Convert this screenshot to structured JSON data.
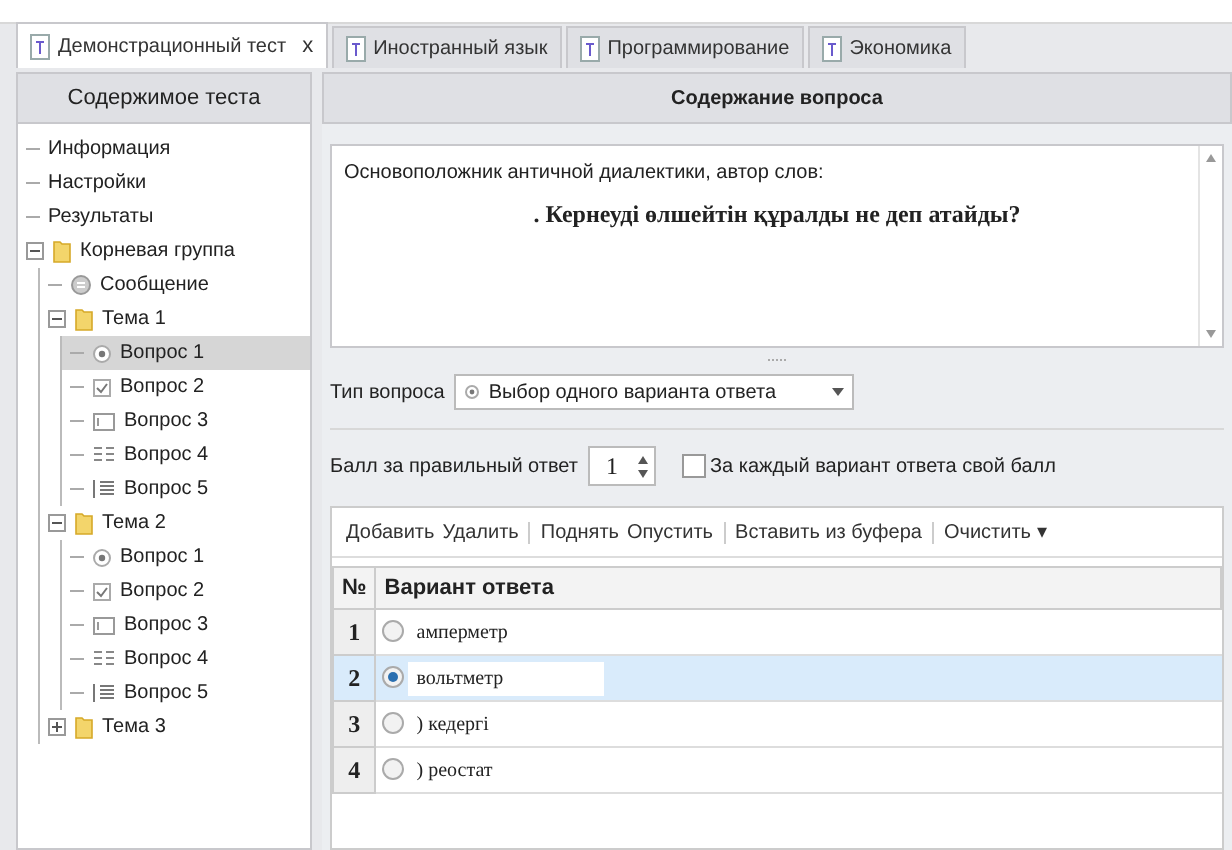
{
  "tabs": [
    {
      "label": "Демонстрационный тест",
      "selected": true,
      "close": "x"
    },
    {
      "label": "Иностранный язык",
      "selected": false
    },
    {
      "label": "Программирование",
      "selected": false
    },
    {
      "label": "Экономика",
      "selected": false
    }
  ],
  "tree": {
    "title": "Содержимое теста",
    "items": [
      {
        "label": "Информация",
        "kind": "page",
        "selected": false
      },
      {
        "label": "Настройки",
        "kind": "page",
        "selected": false
      },
      {
        "label": "Результаты",
        "kind": "page",
        "selected": false
      },
      {
        "label": "Корневая группа",
        "kind": "folder",
        "selected": false,
        "expanded": true,
        "children": [
          {
            "label": "Сообщение",
            "kind": "message",
            "selected": false
          },
          {
            "label": "Тема 1",
            "kind": "folder",
            "selected": false,
            "expanded": true,
            "children": [
              {
                "label": "Вопрос 1",
                "kind": "single",
                "selected": true
              },
              {
                "label": "Вопрос 2",
                "kind": "multiple",
                "selected": false
              },
              {
                "label": "Вопрос 3",
                "kind": "text",
                "selected": false
              },
              {
                "label": "Вопрос 4",
                "kind": "matching",
                "selected": false
              },
              {
                "label": "Вопрос 5",
                "kind": "ordering",
                "selected": false
              }
            ]
          },
          {
            "label": "Тема 2",
            "kind": "folder",
            "selected": false,
            "expanded": true,
            "children": [
              {
                "label": "Вопрос 1",
                "kind": "single",
                "selected": false
              },
              {
                "label": "Вопрос 2",
                "kind": "multiple",
                "selected": false
              },
              {
                "label": "Вопрос 3",
                "kind": "text",
                "selected": false
              },
              {
                "label": "Вопрос 4",
                "kind": "matching",
                "selected": false
              },
              {
                "label": "Вопрос 5",
                "kind": "ordering",
                "selected": false
              }
            ]
          },
          {
            "label": "Тема 3",
            "kind": "folder",
            "selected": false,
            "expanded": false
          }
        ]
      }
    ]
  },
  "question": {
    "title": "Содержание вопроса",
    "text": "Основоположник античной диалектики, автор слов:",
    "emphasis": ". Кернеуді өлшейтін құралды не деп атайды?",
    "type_label": "Тип вопроса",
    "type_value": "Выбор одного варианта ответа",
    "score_label": "Балл за правильный ответ",
    "score_value": "1",
    "own_score": {
      "label": "За каждый вариант ответа свой балл",
      "checked": false
    },
    "toolbar": [
      {
        "buttons": [
          {
            "label": "Добавить"
          },
          {
            "label": "Удалить"
          }
        ]
      },
      {
        "buttons": [
          {
            "label": "Поднять"
          },
          {
            "label": "Опустить"
          }
        ]
      },
      {
        "buttons": [
          {
            "label": "Вставить из буфера"
          }
        ]
      },
      {
        "buttons": [
          {
            "label": "Очистить",
            "menu": "▾"
          }
        ]
      }
    ],
    "columns": [
      "№",
      "Вариант ответа"
    ],
    "answers": [
      {
        "number": "1",
        "text": "амперметр",
        "correct": false,
        "selected": false
      },
      {
        "number": "2",
        "text": "вольтметр",
        "correct": true,
        "selected": true
      },
      {
        "number": "3",
        "text": ") кедергі",
        "correct": false,
        "selected": false
      },
      {
        "number": "4",
        "text": ") реостат",
        "correct": false,
        "selected": false
      }
    ]
  }
}
